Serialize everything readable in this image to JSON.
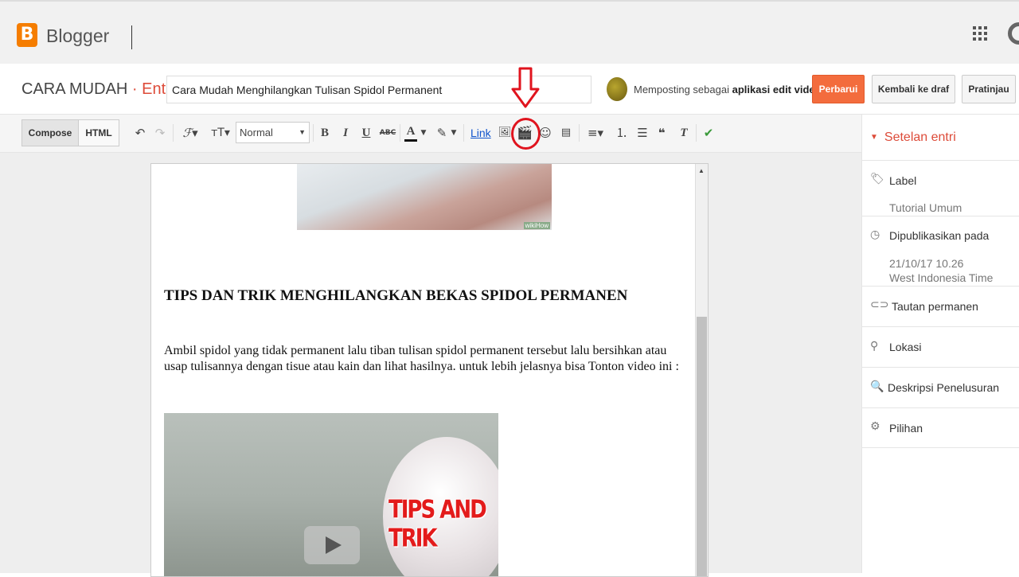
{
  "header": {
    "logo_letter": "B",
    "app_name": "Blogger"
  },
  "post": {
    "blog_name": "CARA MUDAH",
    "separator": "·",
    "section": "Entri",
    "title": "Cara Mudah Menghilangkan Tulisan Spidol Permanent",
    "posting_as_prefix": "Memposting sebagai",
    "posting_as_name": "aplikasi edit video",
    "buttons": {
      "update": "Perbarui",
      "back_to_draft": "Kembali ke draf",
      "preview": "Pratinjau"
    }
  },
  "toolbar": {
    "compose": "Compose",
    "html": "HTML",
    "font_size_style": "Normal",
    "link": "Link",
    "bold": "B",
    "italic": "I",
    "underline": "U",
    "strike": "ABC",
    "text_color": "A"
  },
  "editor": {
    "image_watermark": "wikiHow",
    "heading": "TIPS DAN TRIK MENGHILANGKAN BEKAS SPIDOL PERMANEN",
    "paragraph": "Ambil spidol yang tidak permanent lalu tiban tulisan spidol permanent tersebut lalu bersihkan atau usap tulisannya dengan tisue atau kain dan lihat hasilnya. untuk lebih jelasnya bisa Tonton video ini :",
    "video_overlay_text": "TIPS AND TRIK"
  },
  "sidebar": {
    "title": "Setelan entri",
    "label": "Label",
    "label_value": "Tutorial Umum",
    "published": "Dipublikasikan pada",
    "published_date": "21/10/17 10.26",
    "published_tz": "West Indonesia Time",
    "permalink": "Tautan permanen",
    "location": "Lokasi",
    "search_desc": "Deskripsi Penelusuran",
    "options": "Pilihan"
  },
  "colors": {
    "brand": "#f57d00",
    "accent_red": "#dd4b39",
    "primary_button": "#f36c3d",
    "highlight": "#e0141e"
  }
}
